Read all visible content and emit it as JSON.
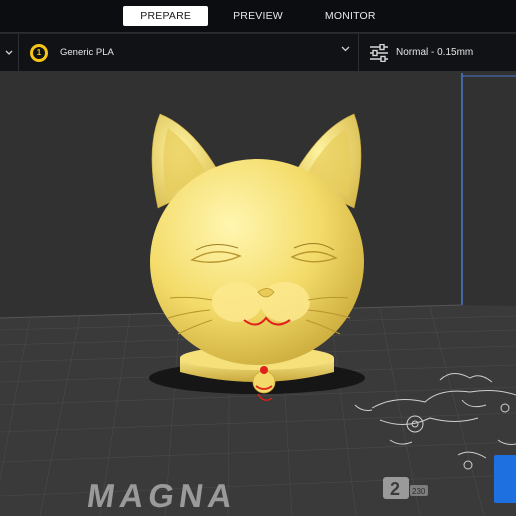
{
  "stages": [
    {
      "label": "PREPARE",
      "active": true
    },
    {
      "label": "PREVIEW",
      "active": false
    },
    {
      "label": "MONITOR",
      "active": false
    }
  ],
  "extruder": {
    "number": "1",
    "material": "Generic PLA"
  },
  "print_profile": {
    "label": "Normal - 0.15mm"
  },
  "build_plate": {
    "brand": "MAGNA",
    "model_number": "2",
    "model_size": "230"
  },
  "colors": {
    "model": "#f7e27a",
    "accent": "#f5c518",
    "overhang": "#e0201a",
    "plate": "#3c3c3c",
    "axis_blue": "#1e6fe0"
  }
}
